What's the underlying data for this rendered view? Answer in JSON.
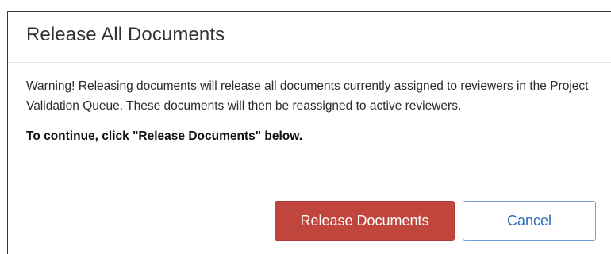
{
  "dialog": {
    "title": "Release All Documents",
    "warning": "Warning! Releasing documents will release all documents currently assigned to reviewers in the Project Validation Queue. These documents will then be reassigned to active reviewers.",
    "instruction": "To continue, click \"Release Documents\" below.",
    "release_button_label": "Release Documents",
    "cancel_button_label": "Cancel"
  },
  "colors": {
    "release_button": "#c0453c",
    "cancel_text": "#2a6db5",
    "cancel_border": "#6ea0d6"
  }
}
